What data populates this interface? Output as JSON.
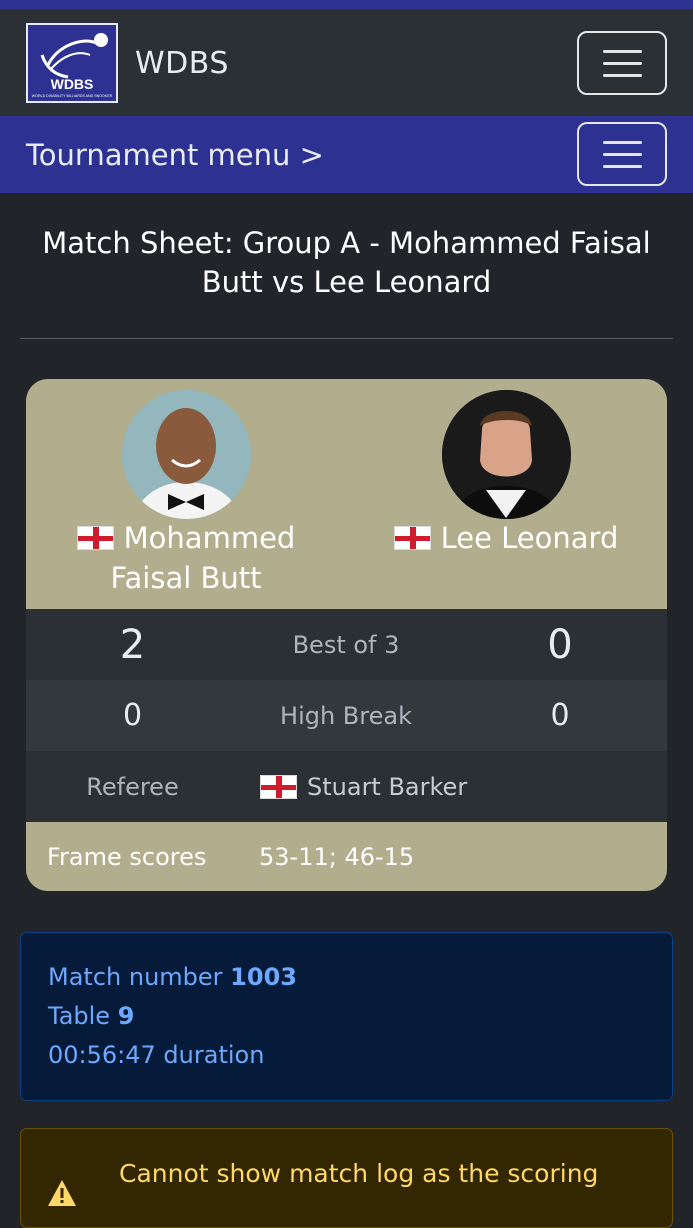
{
  "navbar": {
    "brand": "WDBS",
    "logo_text": "WDBS",
    "logo_subtitle": "WORLD DISABILITY BILLIARDS AND SNOOKER"
  },
  "tournament_bar": {
    "link": "Tournament menu >"
  },
  "page_title": "Match Sheet: Group A - Mohammed Faisal Butt vs Lee Leonard",
  "players": [
    {
      "name": "Mohammed Faisal Butt",
      "country": "England",
      "frames": "2",
      "high_break": "0"
    },
    {
      "name": "Lee Leonard",
      "country": "England",
      "frames": "0",
      "high_break": "0"
    }
  ],
  "match": {
    "best_of_label": "Best of 3",
    "high_break_label": "High Break",
    "referee_label": "Referee",
    "referee_name": "Stuart Barker",
    "frame_scores_label": "Frame scores",
    "frame_scores": "53-11; 46-15"
  },
  "info": {
    "match_number_label": "Match number",
    "match_number": "1003",
    "table_label": "Table",
    "table": "9",
    "duration": "00:56:47 duration"
  },
  "warning": {
    "text": "Cannot show match log as the scoring"
  },
  "colors": {
    "navy": "#2d3192",
    "card": "#b1ad8d",
    "info_bg": "#061a3a",
    "info_text": "#6ea8fe",
    "warn_text": "#ffd866"
  }
}
